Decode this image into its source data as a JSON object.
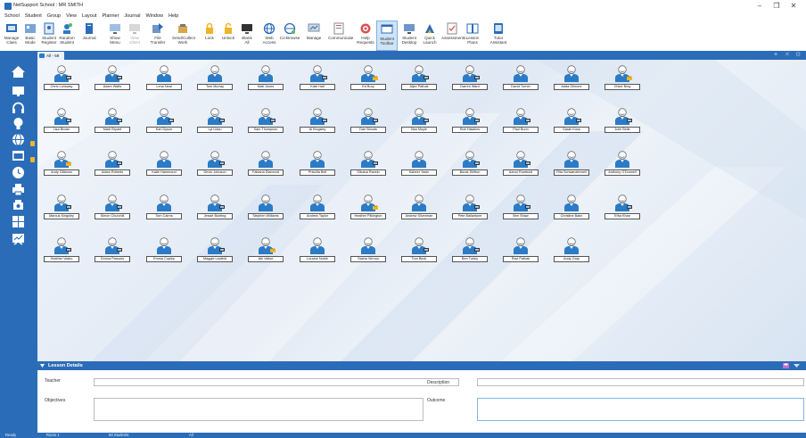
{
  "window": {
    "title": "NetSupport School : MR SMITH",
    "controls": [
      "–",
      "❐",
      "✕"
    ]
  },
  "menu": [
    "School",
    "Student",
    "Group",
    "View",
    "Layout",
    "Planner",
    "Journal",
    "Window",
    "Help"
  ],
  "toolbar": {
    "buttons": [
      {
        "label": "Manage\nClass",
        "icon": "manage-class-icon"
      },
      {
        "label": "Basic\nMode",
        "icon": "basic-mode-icon"
      },
      {
        "label": "Student\nRegister",
        "icon": "student-register-icon"
      },
      {
        "label": "Random\nStudent",
        "icon": "random-student-icon"
      },
      {
        "label": "Journal",
        "icon": "journal-icon"
      },
      {
        "label": "Show\nMenu",
        "icon": "show-icon"
      },
      {
        "label": "View\nClient",
        "icon": "view-icon",
        "disabled": true
      },
      {
        "label": "File\nTransfer",
        "icon": "file-transfer-icon"
      },
      {
        "label": "Send/Collect\nWork",
        "icon": "send-collect-icon"
      },
      {
        "label": "Lock",
        "icon": "lock-icon"
      },
      {
        "label": "Unlock",
        "icon": "unlock-icon"
      },
      {
        "label": "Blank\nAll",
        "icon": "blank-icon"
      },
      {
        "label": "Web\nAccess",
        "icon": "web-icon"
      },
      {
        "label": "Co-Browse",
        "icon": "co-browse-icon"
      },
      {
        "label": "Manage",
        "icon": "manage-icon"
      },
      {
        "label": "Communicate",
        "icon": "communicate-icon"
      },
      {
        "label": "Help\nRequests",
        "icon": "help-icon"
      },
      {
        "label": "Student\nToolbar",
        "icon": "student-toolbar-icon",
        "active": true
      },
      {
        "label": "Student\nDesktop",
        "icon": "student-desktop-icon"
      },
      {
        "label": "Quick\nLaunch",
        "icon": "quick-launch-icon"
      },
      {
        "label": "Assessments",
        "icon": "assessments-icon"
      },
      {
        "label": "Lesson\nPlans",
        "icon": "lesson-plans-icon"
      },
      {
        "label": "Tutor\nAssistant",
        "icon": "tutor-assistant-icon"
      }
    ]
  },
  "tabs": {
    "active": "All - 59",
    "controls": [
      "+",
      "✕",
      "⚙"
    ]
  },
  "sidebar": {
    "items": [
      "home-icon",
      "monitor-icon",
      "headset-icon",
      "lightbulb-icon",
      "globe-icon",
      "app-window-icon",
      "clock-icon",
      "printer-icon",
      "usb-icon",
      "grid-icon",
      "whiteboard-icon"
    ]
  },
  "students": [
    {
      "name": "Chris Lonsway",
      "badge": "monitor"
    },
    {
      "name": "Adam Watts",
      "badge": "monitor"
    },
    {
      "name": "Lena Neal",
      "badge": ""
    },
    {
      "name": "Tom Murray",
      "badge": ""
    },
    {
      "name": "Mati Jones",
      "badge": ""
    },
    {
      "name": "Kate Hall",
      "badge": "monitor"
    },
    {
      "name": "Ed Bury",
      "badge": "lock"
    },
    {
      "name": "Aljev Pathak",
      "badge": "monitor"
    },
    {
      "name": "Darren Ward",
      "badge": "monitor"
    },
    {
      "name": "David Turner",
      "badge": ""
    },
    {
      "name": "Adda Gilmore",
      "badge": ""
    },
    {
      "name": "Chloe Bray",
      "badge": "lock"
    },
    {
      "name": "Lisa Brown",
      "badge": "monitor"
    },
    {
      "name": "Mark Bryant",
      "badge": "monitor"
    },
    {
      "name": "Karl Dyson",
      "badge": "monitor"
    },
    {
      "name": "Lyl Lidou",
      "badge": "monitor"
    },
    {
      "name": "Sam Thompson",
      "badge": "monitor"
    },
    {
      "name": "Al Kingsley",
      "badge": "monitor"
    },
    {
      "name": "Dan Woods",
      "badge": "monitor"
    },
    {
      "name": "Ilisa Moyle",
      "badge": "monitor"
    },
    {
      "name": "Rob Hawkins",
      "badge": "monitor"
    },
    {
      "name": "Paul Bunn",
      "badge": "monitor"
    },
    {
      "name": "Sarah Koss",
      "badge": "monitor"
    },
    {
      "name": "Julie Belle",
      "badge": "monitor"
    },
    {
      "name": "Andy Gibbons",
      "badge": "lock"
    },
    {
      "name": "Adam Roberts",
      "badge": "monitor"
    },
    {
      "name": "Katie Hammond",
      "badge": ""
    },
    {
      "name": "Devin Johnson",
      "badge": "monitor"
    },
    {
      "name": "Fabiana Diamond",
      "badge": ""
    },
    {
      "name": "Priscilla Bell",
      "badge": ""
    },
    {
      "name": "Silvana Ravelo",
      "badge": "monitor"
    },
    {
      "name": "Kabeer Yasin",
      "badge": ""
    },
    {
      "name": "Burak Shifton",
      "badge": "monitor"
    },
    {
      "name": "Aaron Rumbold",
      "badge": "monitor"
    },
    {
      "name": "Rita Schwanzfernell",
      "badge": ""
    },
    {
      "name": "Anthony O'Donnell",
      "badge": ""
    },
    {
      "name": "Marcus Kingsley",
      "badge": "monitor"
    },
    {
      "name": "Simon Churchill",
      "badge": "monitor"
    },
    {
      "name": "Tom Cairns",
      "badge": ""
    },
    {
      "name": "Jessie Bunting",
      "badge": "monitor"
    },
    {
      "name": "Stephen Williams",
      "badge": ""
    },
    {
      "name": "Andrew Taylor",
      "badge": ""
    },
    {
      "name": "Heather Pilkington",
      "badge": "lock"
    },
    {
      "name": "Andrew Silverman",
      "badge": ""
    },
    {
      "name": "Pete Ballantyne",
      "badge": "monitor"
    },
    {
      "name": "Ben Shaw",
      "badge": "monitor"
    },
    {
      "name": "Christine Bakn",
      "badge": ""
    },
    {
      "name": "Etha Khan",
      "badge": "monitor"
    },
    {
      "name": "Heather Vasko",
      "badge": "monitor"
    },
    {
      "name": "Donna Parsons",
      "badge": "monitor"
    },
    {
      "name": "Emma Copley",
      "badge": ""
    },
    {
      "name": "Maggie Laufeld",
      "badge": "monitor"
    },
    {
      "name": "Abi Valloe",
      "badge": "lock"
    },
    {
      "name": "Loraine Noble",
      "badge": ""
    },
    {
      "name": "Sasha Vernou",
      "badge": ""
    },
    {
      "name": "Tom Beck",
      "badge": "monitor"
    },
    {
      "name": "Ben Turley",
      "badge": "monitor"
    },
    {
      "name": "Ravi Pathak",
      "badge": ""
    },
    {
      "name": "Andy Gray",
      "badge": ""
    }
  ],
  "lesson": {
    "title": "Lesson Details",
    "teacher_label": "Teacher",
    "teacher_value": "",
    "description_label": "Description",
    "description_value": "",
    "objectives_label": "Objectives",
    "objectives_value": "",
    "outcome_label": "Outcome",
    "outcome_value": ""
  },
  "status": {
    "state": "Ready",
    "room": "Room 1",
    "count": "59 Students",
    "group": "All"
  },
  "colors": {
    "accent": "#2b6cb8",
    "avatar": "#2b7bc6",
    "lock": "#f0b429"
  }
}
